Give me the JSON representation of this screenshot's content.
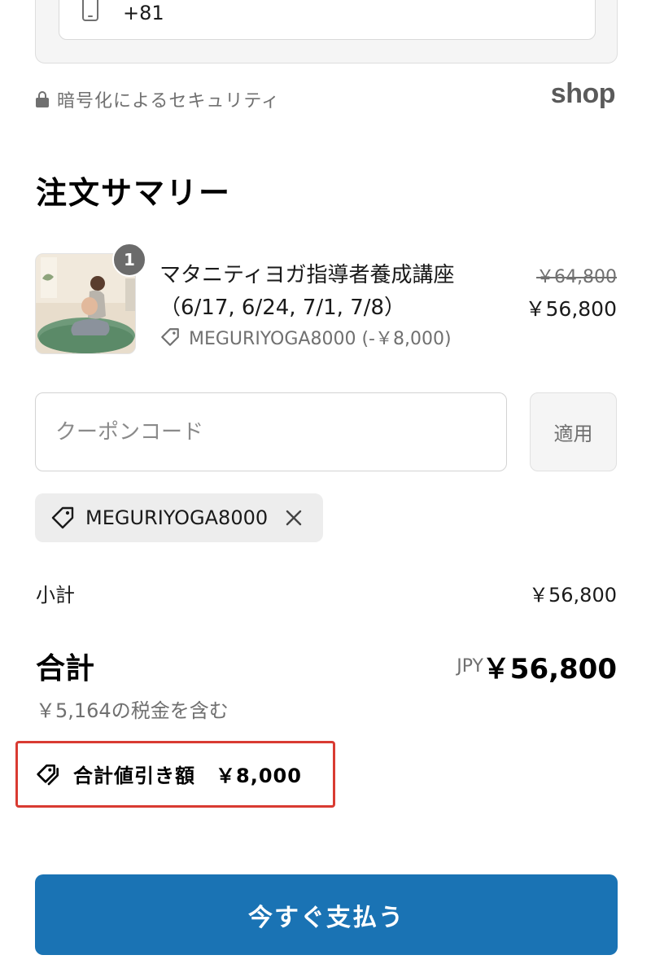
{
  "phone": {
    "country_code": "+81",
    "icon": "phone-icon"
  },
  "security": {
    "text": "暗号化によるセキュリティ",
    "icon": "lock-icon",
    "brand": "shop"
  },
  "summary": {
    "title": "注文サマリー",
    "item": {
      "quantity": "1",
      "name": "マタニティヨガ指導者養成講座（6/17, 6/24, 7/1, 7/8）",
      "discount": "MEGURIYOGA8000 (-￥8,000)",
      "original_price": "￥64,800",
      "price": "￥56,800",
      "thumbnail": "maternity-yoga-photo"
    }
  },
  "coupon": {
    "placeholder": "クーポンコード",
    "apply_label": "適用",
    "applied_code": "MEGURIYOGA8000"
  },
  "totals": {
    "subtotal_label": "小計",
    "subtotal_value": "￥56,800",
    "total_label": "合計",
    "currency": "JPY",
    "total_value": "￥56,800",
    "tax_note": "￥5,164の税金を含む",
    "savings": "合計値引き額　￥8,000"
  },
  "pay_button": {
    "label": "今すぐ支払う",
    "color": "#1a73b4"
  },
  "colors": {
    "highlight_box": "#d93b32",
    "muted_text": "#707070"
  }
}
